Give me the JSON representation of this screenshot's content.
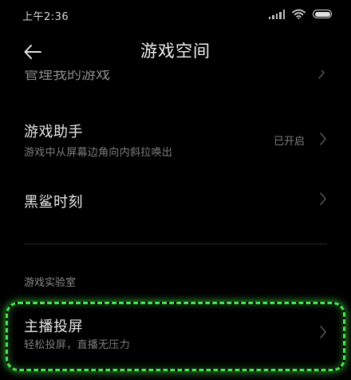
{
  "status_bar": {
    "time": "上午2:36",
    "signal_icon": "signal-icon",
    "wifi_icon": "wifi-icon",
    "battery_icon": "battery-icon"
  },
  "header": {
    "back_icon": "arrow-left-icon",
    "title": "游戏空间"
  },
  "settings": {
    "clipped_item": {
      "label": "管理我的游戏",
      "icon": "chevron-right-icon"
    },
    "items": [
      {
        "title": "游戏助手",
        "subtitle": "游戏中从屏幕边角向内斜拉唤出",
        "status": "已开启",
        "icon": "chevron-right-icon"
      },
      {
        "title": "黑鲨时刻",
        "icon": "chevron-right-icon"
      }
    ],
    "lab_section": {
      "header": "游戏实验室",
      "items": [
        {
          "title": "主播投屏",
          "subtitle": "轻松投屏，直播无压力",
          "icon": "chevron-right-icon",
          "highlighted": true
        }
      ]
    }
  },
  "colors": {
    "background": "#000000",
    "highlight": "#49e34f",
    "text_primary": "#e8e8e8",
    "text_secondary": "#7d7d7d"
  }
}
